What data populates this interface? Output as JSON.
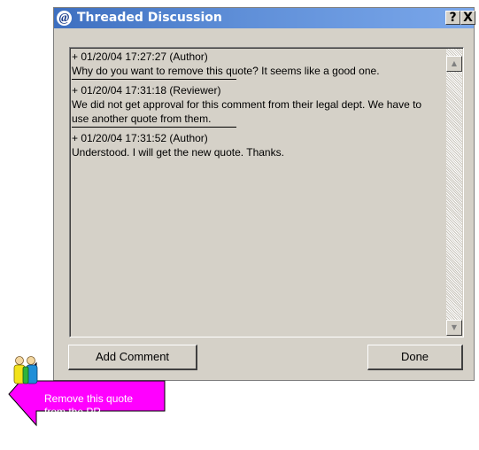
{
  "window": {
    "title": "Threaded Discussion",
    "help_label": "?",
    "close_label": "X"
  },
  "thread": {
    "entries": [
      {
        "meta": "+ 01/20/04 17:27:27 (Author)",
        "text": "Why do you want to remove this quote? It seems like a good one."
      },
      {
        "meta": "+ 01/20/04 17:31:18 (Reviewer)",
        "text": "We did not get approval for this comment from their legal dept. We have to use another quote from them."
      },
      {
        "meta": "+ 01/20/04 17:31:52 (Author)",
        "text": "Understood. I will get the new quote. Thanks."
      }
    ]
  },
  "buttons": {
    "add_comment": "Add Comment",
    "done": "Done"
  },
  "annotation": {
    "line1": "Remove this quote",
    "line2": "from the PR"
  },
  "colors": {
    "titlebar": "#3d6fc0",
    "dialog_bg": "#d5d1c8",
    "callout_fill": "#ff00ff"
  },
  "icons": {
    "app": "app-logo-icon",
    "reviewers": "people-icon",
    "scroll_up": "scroll-up-arrow-icon",
    "scroll_down": "scroll-down-arrow-icon"
  }
}
